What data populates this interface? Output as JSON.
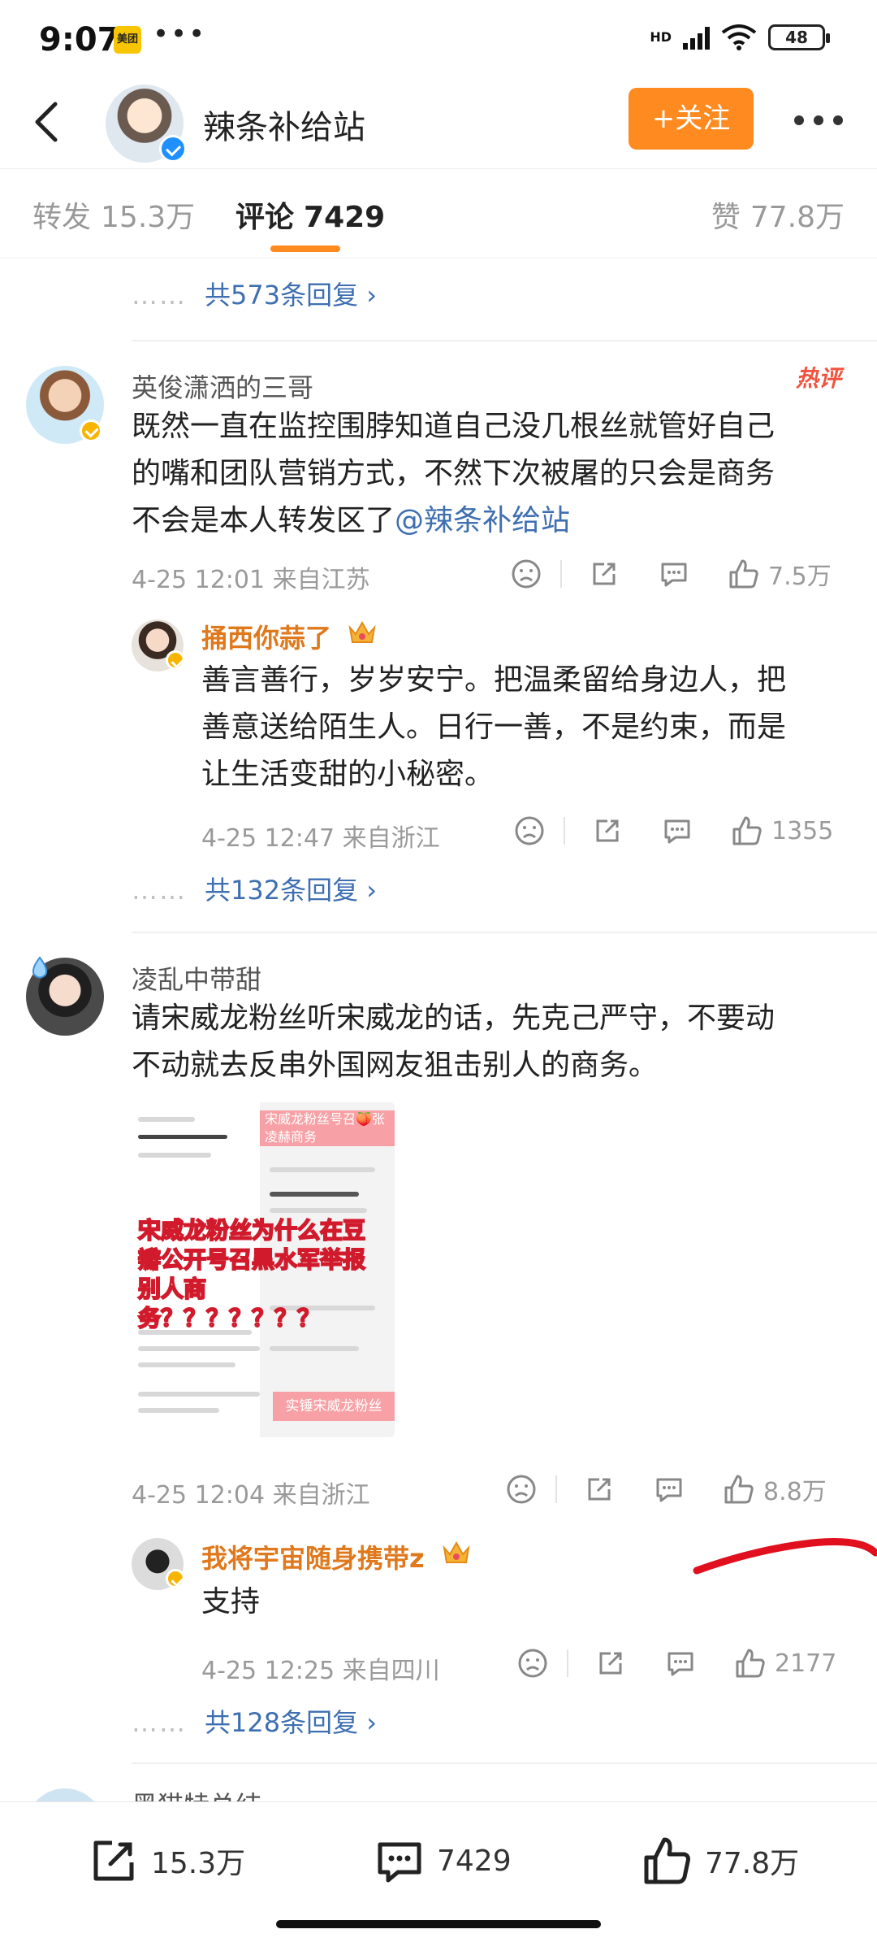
{
  "status_bar": {
    "time": "9:07",
    "app_badge": "美团",
    "more": "•••",
    "network": "HD",
    "battery": "48"
  },
  "header": {
    "title": "辣条补给站",
    "follow_label": "+关注"
  },
  "tabs": {
    "repost": {
      "label": "转发",
      "count": "15.3万"
    },
    "comment": {
      "label": "评论",
      "count": "7429"
    },
    "like": {
      "label": "赞",
      "count": "77.8万"
    }
  },
  "top_reply_link": "共573条回复",
  "comments": [
    {
      "username": "英俊潇洒的三哥",
      "hot_tag": "热评",
      "text_line1": "既然一直在监控围脖知道自己没几根丝就管好自己",
      "text_line2": "的嘴和团队营销方式，不然下次被屠的只会是商务",
      "text_line3_prefix": "不会是本人转发区了",
      "mention": "@辣条补给站",
      "meta": "4-25 12:01 来自江苏",
      "likes": "7.5万",
      "reply": {
        "username": "捅西你蒜了",
        "text_line1": "善言善行，岁岁安宁。把温柔留给身边人，把",
        "text_line2": "善意送给陌生人。日行一善，不是约束，而是",
        "text_line3": "让生活变甜的小秘密。",
        "meta": "4-25 12:47 来自浙江",
        "likes": "1355"
      },
      "more_replies": "共132条回复"
    },
    {
      "username": "凌乱中带甜",
      "text_line1": "请宋威龙粉丝听宋威龙的话，先克己严守，不要动",
      "text_line2": "不动就去反串外国网友狙击别人的商务。",
      "image": {
        "band_top": "宋威龙粉丝号召🍑张凌赫商务",
        "overlay": "宋威龙粉丝为什么在豆瓣公开号召黑水军举报别人商务？？？？？？？",
        "band_bottom": "实锤宋威龙粉丝"
      },
      "meta": "4-25 12:04 来自浙江",
      "likes": "8.8万",
      "reply": {
        "username": "我将宇宙随身携带z",
        "text_line1": "支持",
        "meta": "4-25 12:25 来自四川",
        "likes": "2177"
      },
      "more_replies": "共128条回复"
    }
  ],
  "next_username_partial": "黑猫特总结",
  "bottom_bar": {
    "repost": "15.3万",
    "comment": "7429",
    "like": "77.8万"
  },
  "colors": {
    "accent": "#ff8a1f",
    "link": "#3e6fb0",
    "hot": "#f2533e",
    "gold_name": "#e0781c",
    "scribble": "#e0101e"
  }
}
